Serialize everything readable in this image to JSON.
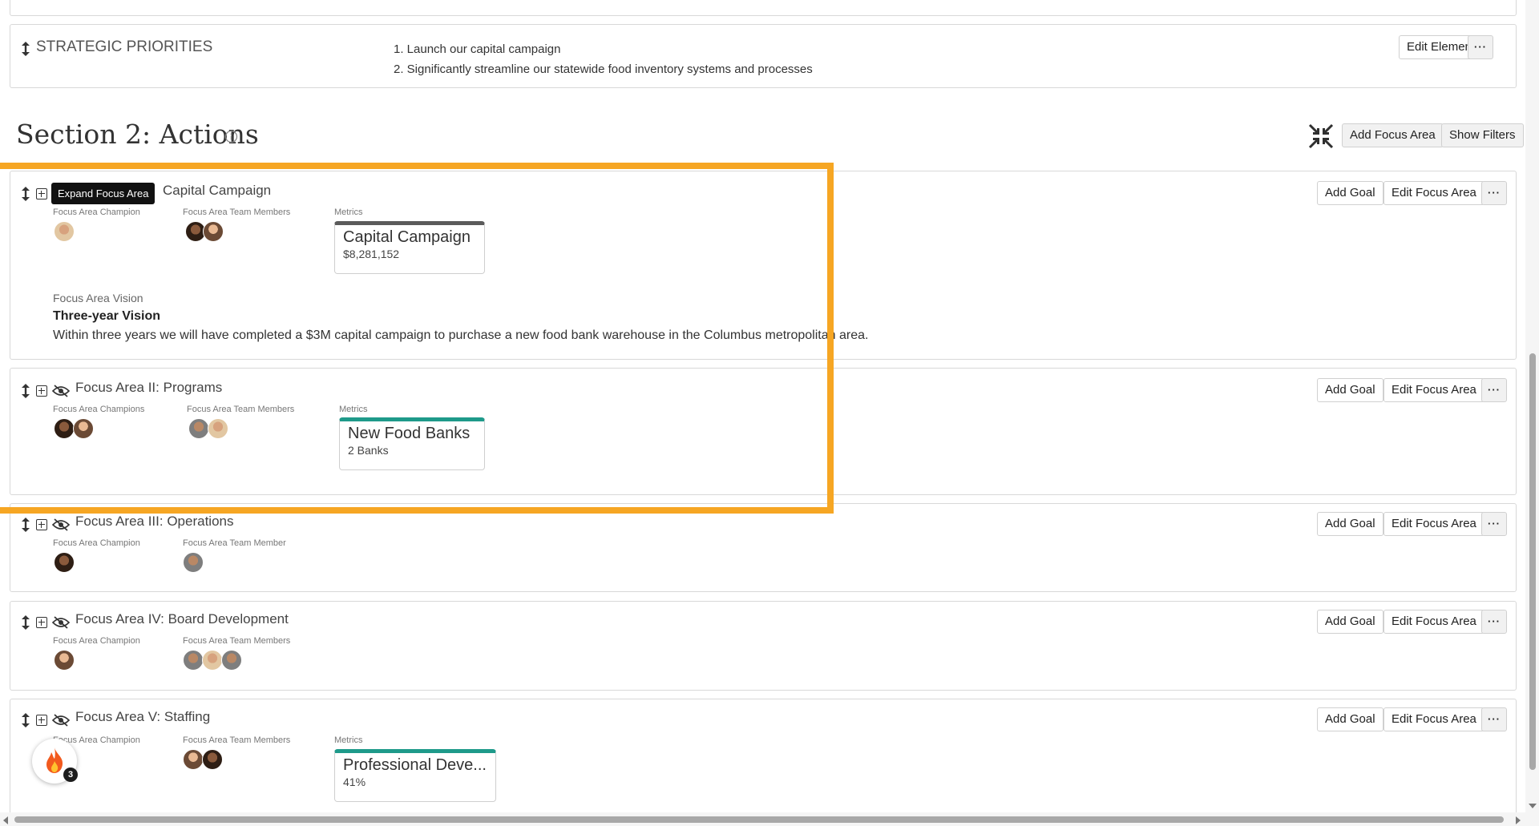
{
  "strategic": {
    "title": "STRATEGIC PRIORITIES",
    "items": [
      "1. Launch our capital campaign",
      "2. Significantly streamline our statewide food inventory systems and processes"
    ],
    "edit_label": "Edit Element",
    "more_label": "···"
  },
  "section": {
    "title": "Section 2: Actions",
    "add_focus_label": "Add Focus Area",
    "show_filters_label": "Show Filters"
  },
  "tooltip": "Expand Focus Area",
  "focus_areas": [
    {
      "title": "Capital Campaign",
      "champion_label": "Focus Area Champion",
      "team_label": "Focus Area Team Members",
      "metrics_label": "Metrics",
      "metric": {
        "name": "Capital Campaign",
        "value": "$8,281,152",
        "color": "#5b5b5b"
      },
      "vision_label": "Focus Area Vision",
      "vision_title": "Three-year Vision",
      "vision_text": "Within three years we will have completed a $3M capital campaign to purchase a new food bank warehouse in the Columbus metropolitan area."
    },
    {
      "title": "Focus Area II: Programs",
      "champion_label": "Focus Area Champions",
      "team_label": "Focus Area Team Members",
      "metrics_label": "Metrics",
      "metric": {
        "name": "New Food Banks",
        "value": "2 Banks",
        "color": "#1e9a8a"
      }
    },
    {
      "title": "Focus Area III: Operations",
      "champion_label": "Focus Area Champion",
      "team_label": "Focus Area Team Member"
    },
    {
      "title": "Focus Area IV: Board Development",
      "champion_label": "Focus Area Champion",
      "team_label": "Focus Area Team Members"
    },
    {
      "title": "Focus Area V: Staffing",
      "champion_label": "Focus Area Champion",
      "team_label": "Focus Area Team Members",
      "metrics_label": "Metrics",
      "metric": {
        "name": "Professional Deve...",
        "value": "41%",
        "color": "#1e9a8a"
      }
    }
  ],
  "actions": {
    "add_goal": "Add Goal",
    "edit_focus": "Edit Focus Area",
    "more": "···"
  },
  "badge": {
    "count": "3"
  },
  "colors": {
    "highlight": "#f6a623"
  }
}
